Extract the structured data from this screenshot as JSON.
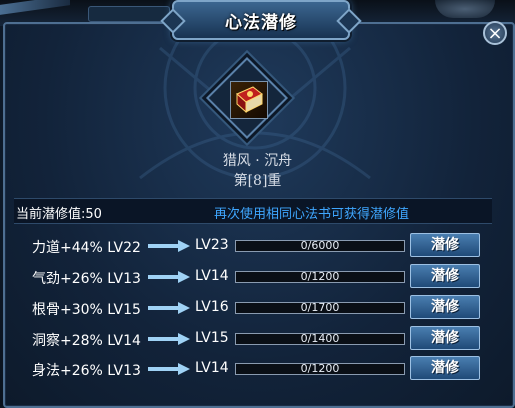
{
  "dialog": {
    "title": "心法潜修",
    "close_label": "×"
  },
  "book": {
    "name": "猎风 · 沉舟",
    "level": "第[8]重",
    "icon": "red-book-icon"
  },
  "info": {
    "current_points": "当前潜修值:50",
    "hint": "再次使用相同心法书可获得潜修值"
  },
  "colors": {
    "accent": "#3fa7ff",
    "panel_border": "#4e6f92",
    "button": "#2d5f92"
  },
  "rows": [
    {
      "stat": "力道+44% LV22",
      "next": "LV23",
      "progress_text": "0/6000",
      "progress_fraction": 0,
      "button": "潜修"
    },
    {
      "stat": "气劲+26% LV13",
      "next": "LV14",
      "progress_text": "0/1200",
      "progress_fraction": 0,
      "button": "潜修"
    },
    {
      "stat": "根骨+30% LV15",
      "next": "LV16",
      "progress_text": "0/1700",
      "progress_fraction": 0,
      "button": "潜修"
    },
    {
      "stat": "洞察+28% LV14",
      "next": "LV15",
      "progress_text": "0/1400",
      "progress_fraction": 0,
      "button": "潜修"
    },
    {
      "stat": "身法+26% LV13",
      "next": "LV14",
      "progress_text": "0/1200",
      "progress_fraction": 0,
      "button": "潜修"
    }
  ]
}
